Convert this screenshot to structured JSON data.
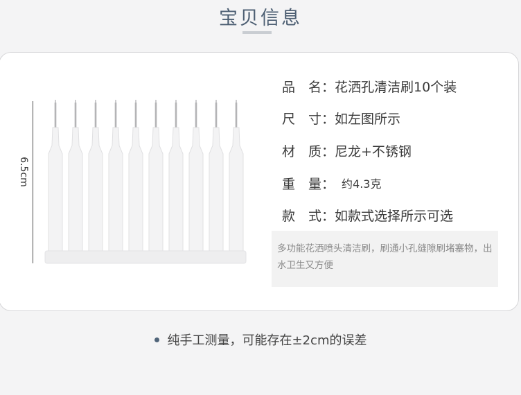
{
  "header": {
    "title": "宝贝信息"
  },
  "dimension": {
    "label": "6.5cm"
  },
  "specs": [
    {
      "label": "品　名：",
      "value": "花洒孔清洁刷10个装"
    },
    {
      "label": "尺　寸：",
      "value": "如左图所示"
    },
    {
      "label": "材　质：",
      "value": "尼龙+不锈钢"
    },
    {
      "label": "重　量：",
      "value": "约4.3克"
    },
    {
      "label": "款　式：",
      "value": "如款式选择所示可选"
    }
  ],
  "description": "多功能花洒喷头清洁刷，刷通小孔缝隙刷堵塞物，出水卫生又方便",
  "note": "纯手工测量，可能存在±2cm的误差",
  "colors": {
    "accent": "#4c5e72",
    "dot": "#4f6479"
  }
}
